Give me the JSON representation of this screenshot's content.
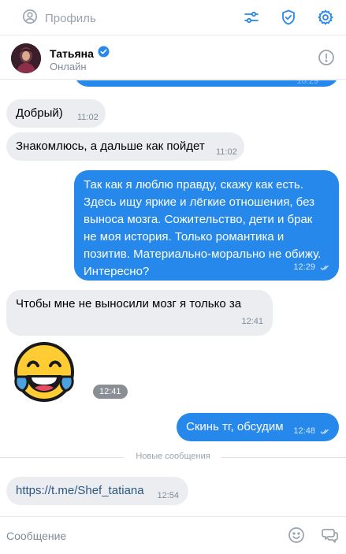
{
  "topbar": {
    "profile_label": "Профиль",
    "icons": [
      "user-circle-icon",
      "sliders-icon",
      "shield-check-icon",
      "gear-icon"
    ]
  },
  "chat": {
    "peer_name": "Татьяна",
    "peer_status": "Онлайн",
    "verified": true
  },
  "messages": [
    {
      "dir": "in",
      "text": "Добрый)",
      "time": "11:02"
    },
    {
      "dir": "in",
      "text": "Знакомлюсь, а дальше как пойдет",
      "time": "11:02"
    },
    {
      "dir": "out",
      "text": "Так как я люблю правду, скажу как есть. Здесь ищу яркие и лёгкие отношения, без выноса мозга. Сожительство, дети и брак не моя история. Только романтика и позитив. Материально-морально не обижу. Интересно?",
      "time": "12:29",
      "read": true
    },
    {
      "dir": "in",
      "text": "Чтобы мне не выносили мозг я только за",
      "time": "12:41"
    },
    {
      "dir": "in",
      "sticker": "tears-of-joy-emoji",
      "time": "12:41"
    },
    {
      "dir": "out",
      "text": "Скинь тг, обсудим",
      "time": "12:48",
      "read": true
    },
    {
      "dir": "in",
      "text": "https://t.me/Shef_tatiana",
      "time": "12:54",
      "link": true
    }
  ],
  "separator": "Новые сообщения",
  "partial_top_time": "10:29",
  "composer": {
    "placeholder": "Сообщение",
    "icons": [
      "smile-icon",
      "chats-icon"
    ]
  },
  "colors": {
    "accent": "#2688eb",
    "bubble_in": "#ebedf0",
    "link": "#2a5885"
  }
}
